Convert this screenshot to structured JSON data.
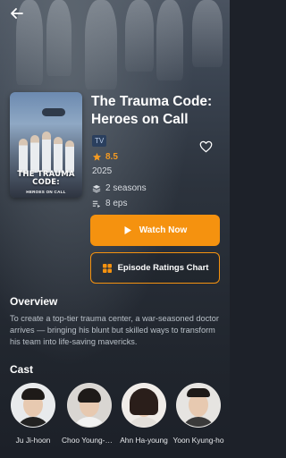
{
  "show": {
    "title": "The Trauma Code: Heroes on Call",
    "type_badge": "TV",
    "rating": "8.5",
    "year": "2025",
    "seasons": "2 seasons",
    "episodes": "8 eps"
  },
  "poster": {
    "title_line1": "THE TRAUMA CODE:",
    "title_line2": "HEROES ON CALL"
  },
  "actions": {
    "watch_label": "Watch Now",
    "ratings_label": "Episode Ratings Chart"
  },
  "overview": {
    "heading": "Overview",
    "text": "To create a top-tier trauma center, a war-seasoned doctor arrives — bringing his blunt but skilled ways to transform his team into life-saving mavericks."
  },
  "cast": {
    "heading": "Cast",
    "members": [
      {
        "name": "Ju Ji-hoon"
      },
      {
        "name": "Choo Young-woo"
      },
      {
        "name": "Ahn Ha-young"
      },
      {
        "name": "Yoon Kyung-ho"
      }
    ]
  },
  "colors": {
    "accent": "#f5920f",
    "badge_bg": "#2a3f5e",
    "text_muted": "#b9c0c8"
  },
  "icons": {
    "back": "arrow-left-icon",
    "favorite": "heart-outline-icon",
    "star": "star-icon",
    "seasons": "layers-icon",
    "episodes": "playlist-icon",
    "play": "play-icon",
    "chart": "grid-chart-icon"
  }
}
